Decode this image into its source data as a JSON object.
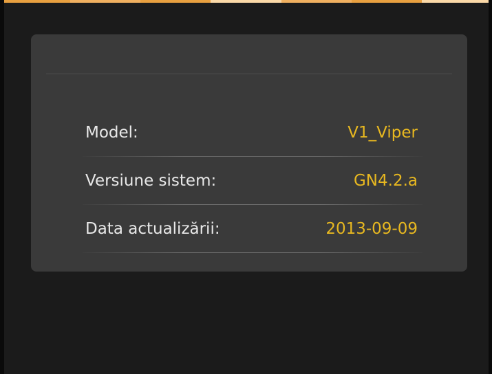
{
  "colors": {
    "background": "#1b1b1b",
    "panel": "#3a3a3a",
    "label_text": "#e8e8e8",
    "value_text": "#e8b820",
    "top_strip": [
      "#e8a040",
      "#f0b060",
      "#e8a040",
      "#fbd9a8",
      "#f0b060",
      "#e8a040",
      "#fbd9a8"
    ]
  },
  "info": {
    "rows": [
      {
        "label": "Model:",
        "value": "V1_Viper"
      },
      {
        "label": "Versiune sistem:",
        "value": "GN4.2.a"
      },
      {
        "label": "Data actualizării:",
        "value": "2013-09-09"
      }
    ]
  }
}
